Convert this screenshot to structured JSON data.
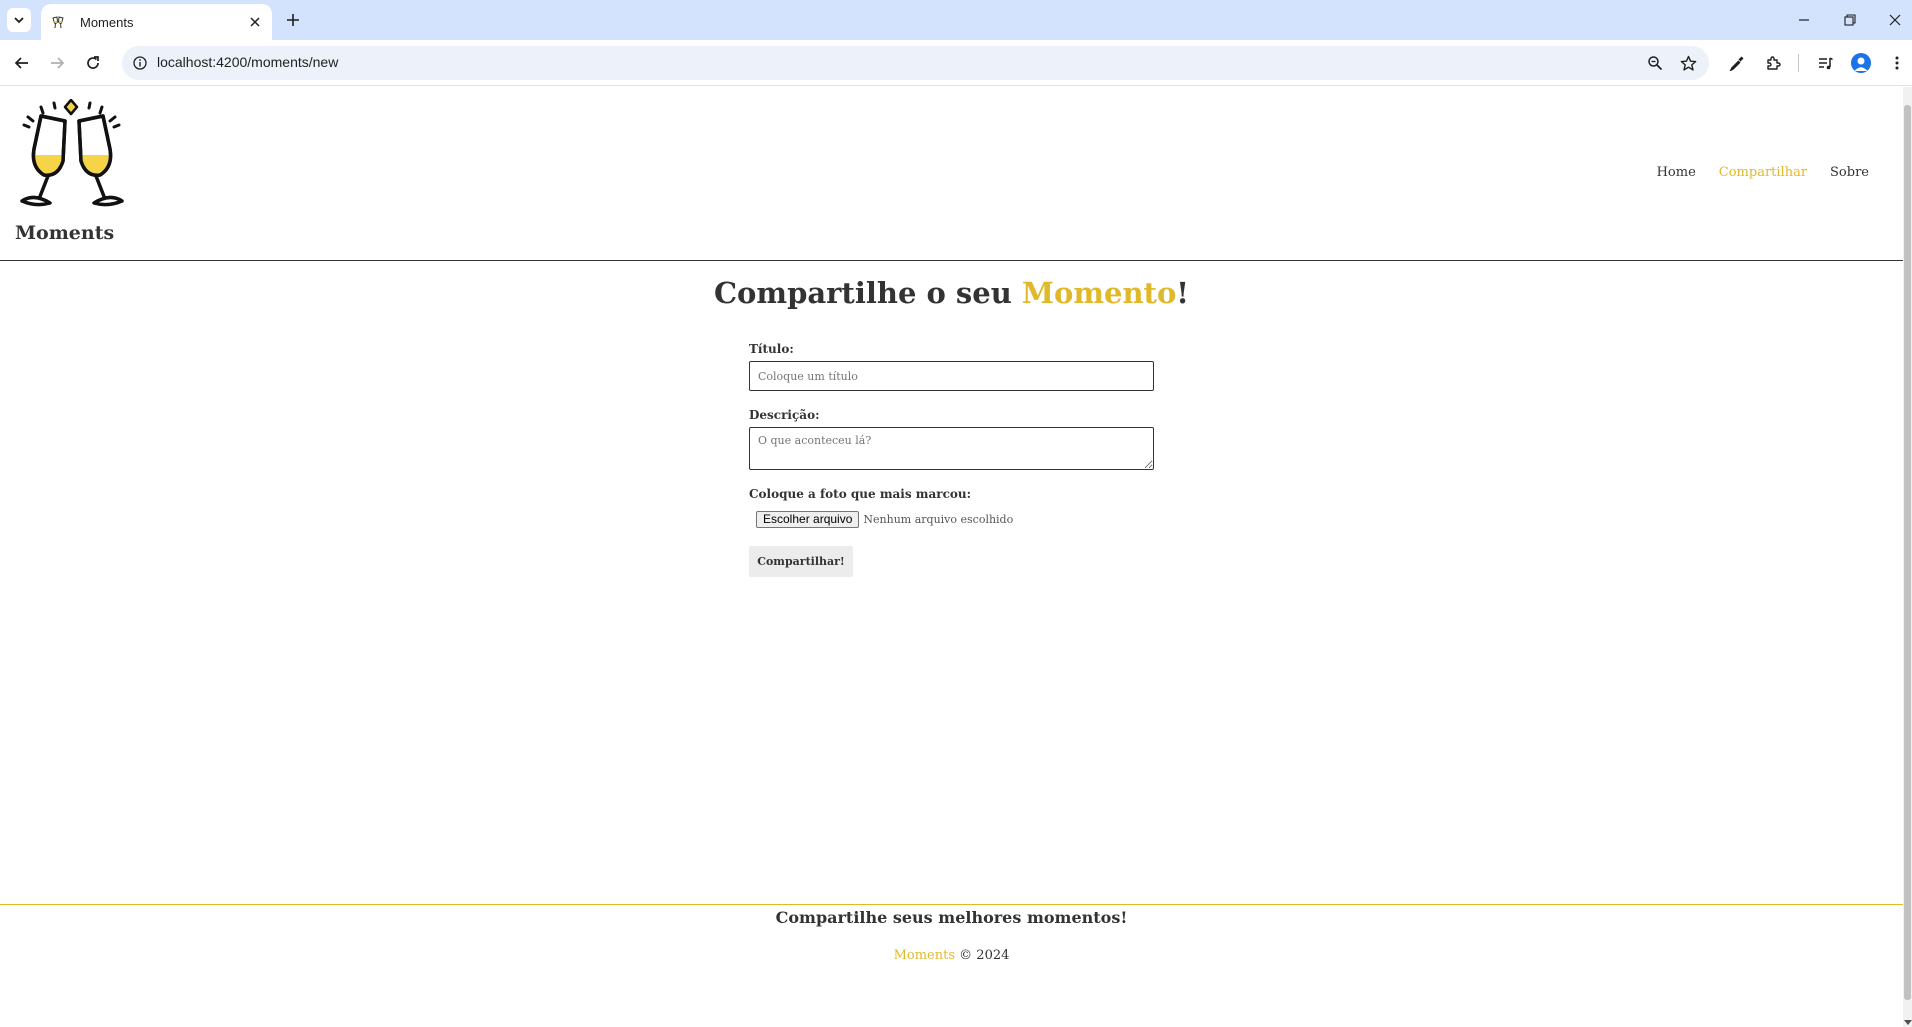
{
  "browser": {
    "tab_title": "Moments",
    "url": "localhost:4200/moments/new"
  },
  "site": {
    "brand": "Moments",
    "nav": [
      {
        "label": "Home",
        "active": false
      },
      {
        "label": "Compartilhar",
        "active": true
      },
      {
        "label": "Sobre",
        "active": false
      }
    ]
  },
  "form_page": {
    "title_prefix": "Compartilhe o seu ",
    "title_accent": "Momento",
    "title_suffix": "!",
    "title_label": "Título:",
    "title_placeholder": "Coloque um título",
    "description_label": "Descrição:",
    "description_placeholder": "O que aconteceu lá?",
    "photo_label": "Coloque a foto que mais marcou:",
    "file_button": "Escolher arquivo",
    "file_status": "Nenhum arquivo escolhido",
    "submit_label": "Compartilhar!"
  },
  "footer": {
    "tagline": "Compartilhe seus melhores momentos!",
    "brand": "Moments",
    "copyright": "© 2024"
  },
  "colors": {
    "accent": "#e0b92a",
    "text": "#333333",
    "tabbar": "#d3e3fd"
  }
}
